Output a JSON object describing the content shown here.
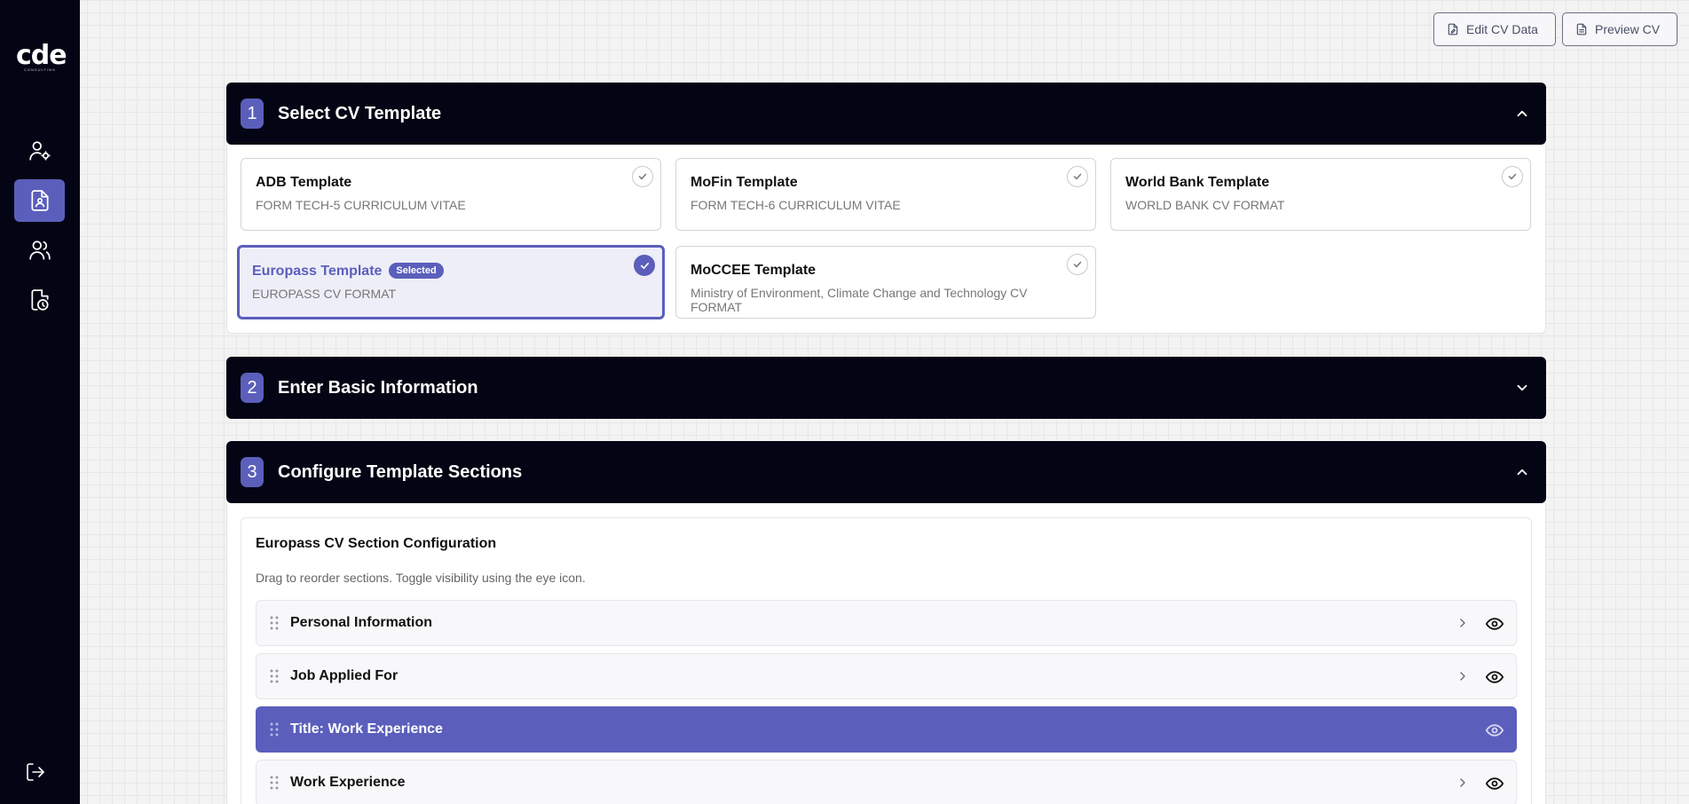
{
  "logo": {
    "word": "cde",
    "sub": "CONSULTING"
  },
  "sidebar": {
    "items": [
      {
        "name": "user-settings",
        "icon": "user-gear-icon",
        "active": false
      },
      {
        "name": "cv-builder",
        "icon": "id-document-icon",
        "active": true
      },
      {
        "name": "team",
        "icon": "users-icon",
        "active": false
      },
      {
        "name": "history",
        "icon": "document-clock-icon",
        "active": false
      }
    ],
    "logout_icon": "logout-icon"
  },
  "toolbar": {
    "edit_label": "Edit CV Data",
    "preview_label": "Preview CV"
  },
  "step1": {
    "number": "1",
    "title": "Select CV Template",
    "templates": [
      {
        "title": "ADB Template",
        "subtitle": "FORM TECH-5 CURRICULUM VITAE",
        "selected": false
      },
      {
        "title": "MoFin Template",
        "subtitle": "FORM TECH-6 CURRICULUM VITAE",
        "selected": false
      },
      {
        "title": "World Bank Template",
        "subtitle": "WORLD BANK CV FORMAT",
        "selected": false
      },
      {
        "title": "Europass Template",
        "subtitle": "EUROPASS CV FORMAT",
        "selected": true,
        "badge": "Selected"
      },
      {
        "title": "MoCCEE Template",
        "subtitle": "Ministry of Environment, Climate Change and Technology CV FORMAT",
        "selected": false
      }
    ]
  },
  "step2": {
    "number": "2",
    "title": "Enter Basic Information"
  },
  "step3": {
    "number": "3",
    "title": "Configure Template Sections",
    "config_title": "Europass CV Section Configuration",
    "config_desc": "Drag to reorder sections. Toggle visibility using the eye icon.",
    "sections": [
      {
        "label": "Personal Information",
        "active": false
      },
      {
        "label": "Job Applied For",
        "active": false
      },
      {
        "label": "Title: Work Experience",
        "active": true
      },
      {
        "label": "Work Experience",
        "active": false
      }
    ]
  },
  "colors": {
    "accent": "#5b5fbb",
    "dark": "#040514",
    "background": "#f3f3f3"
  }
}
